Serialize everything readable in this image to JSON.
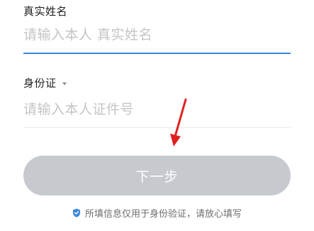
{
  "name_field": {
    "label": "真实姓名",
    "placeholder": "请输入本人 真实姓名"
  },
  "id_field": {
    "label": "身份证",
    "placeholder": "请输入本人证件号"
  },
  "next_button": {
    "label": "下一步"
  },
  "privacy_tip": {
    "text": "所填信息仅用于身份验证，请放心填写",
    "icon": "shield-check-icon"
  },
  "colors": {
    "accent": "#3a88d8",
    "button_disabled": "#c6c9ce",
    "annotation_arrow": "#e02020"
  }
}
